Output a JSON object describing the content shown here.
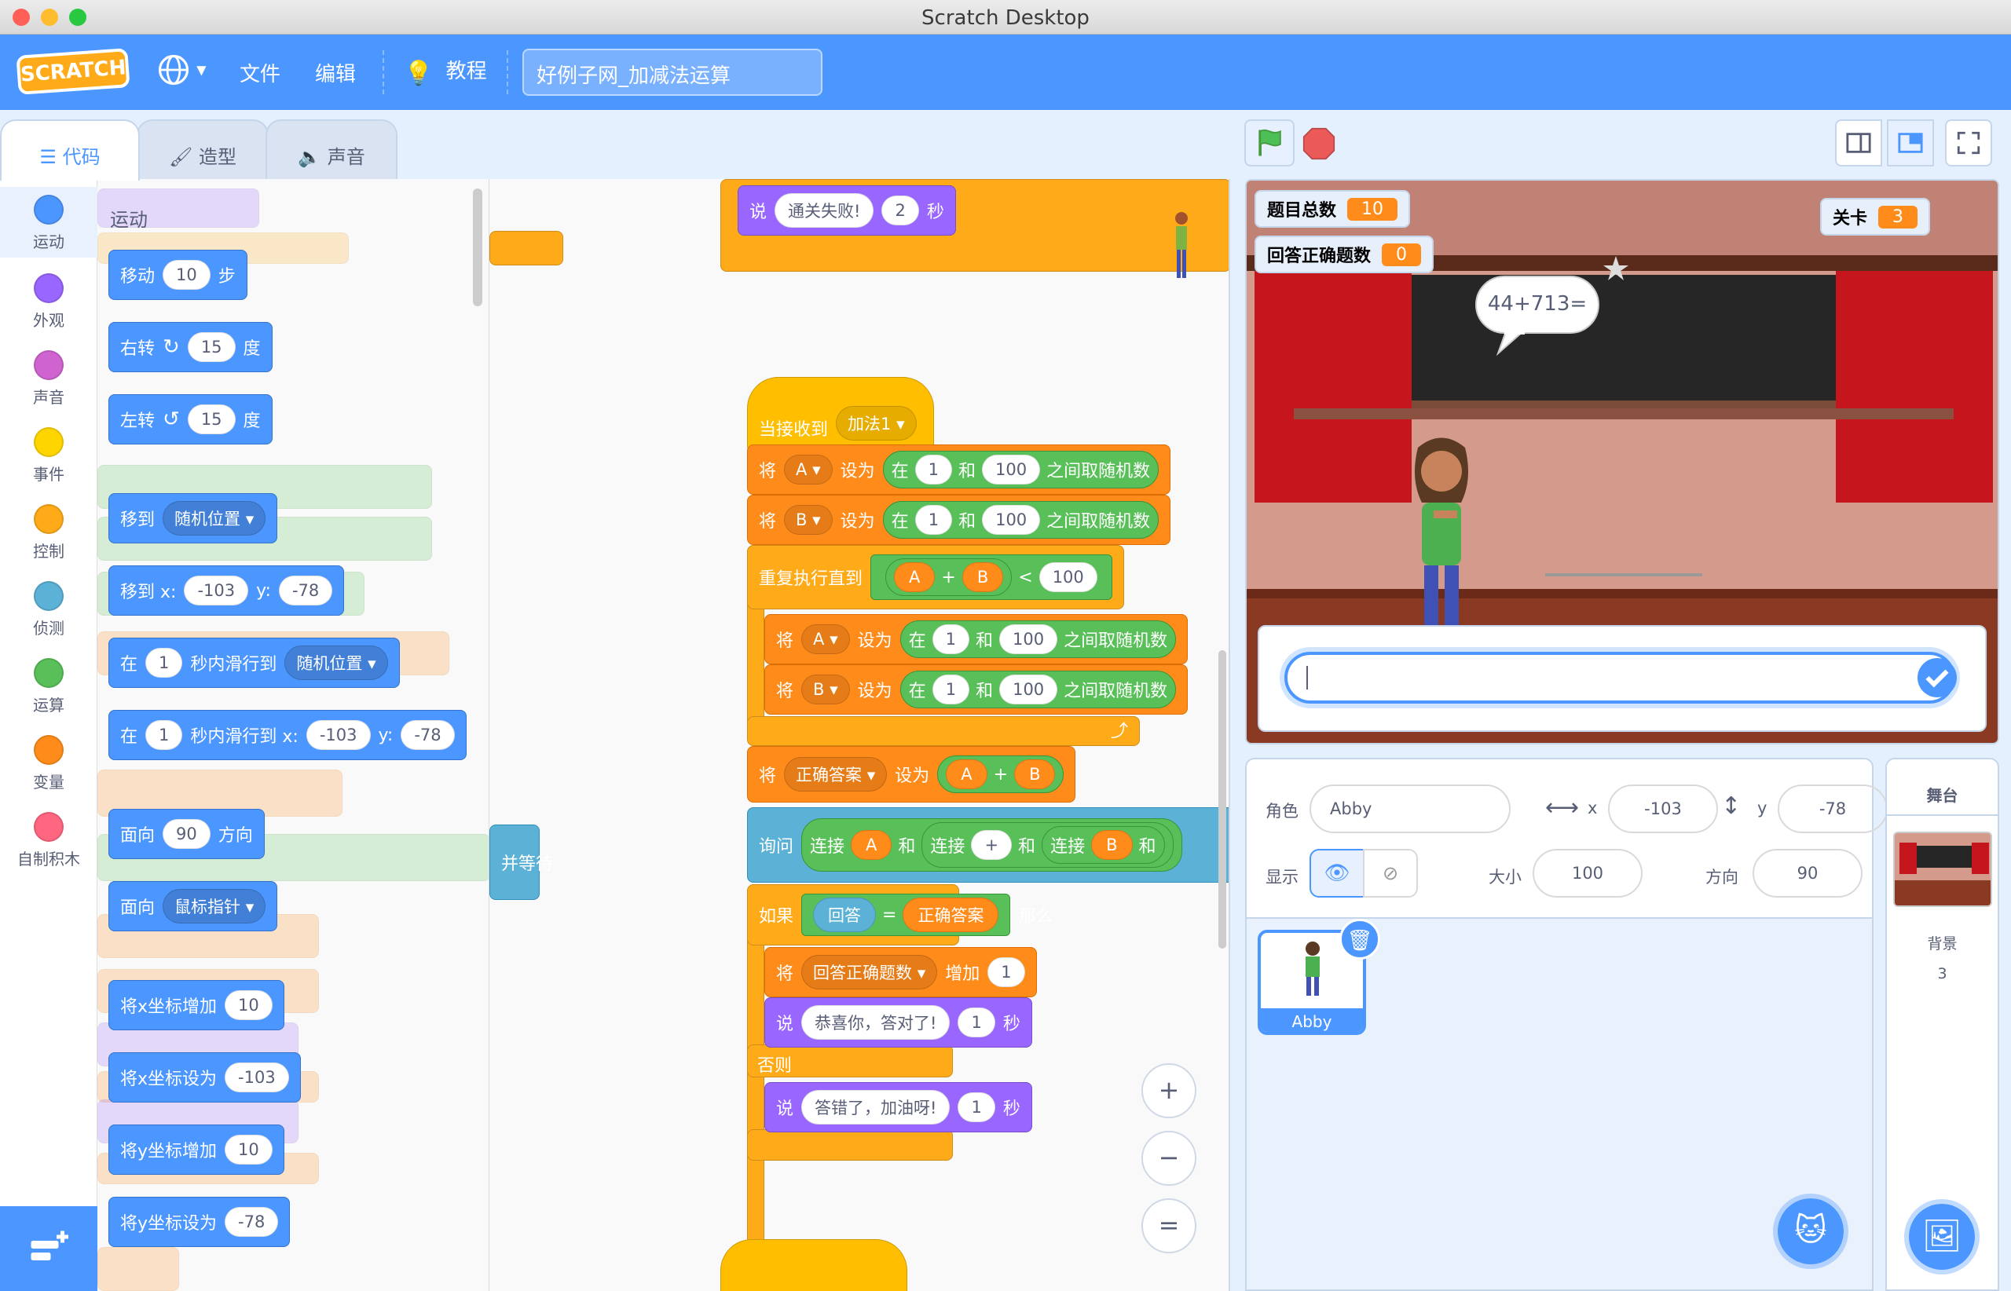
{
  "window": {
    "title": "Scratch Desktop"
  },
  "menubar": {
    "logo": "SCRATCH",
    "file": "文件",
    "edit": "编辑",
    "tutorials": "教程",
    "project_title": "好例子网_加减法运算"
  },
  "tabs": {
    "code": "代码",
    "costumes": "造型",
    "sounds": "声音"
  },
  "categories": [
    {
      "label": "运动",
      "color": "#4c97ff"
    },
    {
      "label": "外观",
      "color": "#9966ff"
    },
    {
      "label": "声音",
      "color": "#cf63cf"
    },
    {
      "label": "事件",
      "color": "#ffd500"
    },
    {
      "label": "控制",
      "color": "#ffab19"
    },
    {
      "label": "侦测",
      "color": "#5cb1d6"
    },
    {
      "label": "运算",
      "color": "#59c059"
    },
    {
      "label": "变量",
      "color": "#ff8c1a"
    },
    {
      "label": "自制积木",
      "color": "#ff6680"
    }
  ],
  "palette": {
    "heading": "运动",
    "move": {
      "label": "移动",
      "value": "10",
      "unit": "步"
    },
    "turn_right": {
      "label": "右转",
      "value": "15",
      "unit": "度"
    },
    "turn_left": {
      "label": "左转",
      "value": "15",
      "unit": "度"
    },
    "goto": {
      "label": "移到",
      "dropdown": "随机位置"
    },
    "goto_xy": {
      "label": "移到 x:",
      "x": "-103",
      "ylabel": "y:",
      "y": "-78"
    },
    "glide": {
      "label": "在",
      "secs": "1",
      "mid": "秒内滑行到",
      "dropdown": "随机位置"
    },
    "glide_xy": {
      "label": "在",
      "secs": "1",
      "mid": "秒内滑行到 x:",
      "x": "-103",
      "ylabel": "y:",
      "y": "-78"
    },
    "point_dir": {
      "label": "面向",
      "value": "90",
      "unit": "方向"
    },
    "point_towards": {
      "label": "面向",
      "dropdown": "鼠标指针"
    },
    "change_x": {
      "label": "将x坐标增加",
      "value": "10"
    },
    "set_x": {
      "label": "将x坐标设为",
      "value": "-103"
    },
    "change_y": {
      "label": "将y坐标增加",
      "value": "10"
    },
    "set_y": {
      "label": "将y坐标设为",
      "value": "-78"
    },
    "behind_wait": "并等待"
  },
  "script": {
    "say_fail": {
      "say": "说",
      "text": "通关失败!",
      "secs": "2",
      "unit": "秒"
    },
    "hat": {
      "label": "当接收到",
      "msg": "加法1"
    },
    "set_a": {
      "set": "将",
      "var": "A",
      "to": "设为",
      "in": "在",
      "from": "1",
      "and": "和",
      "to_val": "100",
      "rand": "之间取随机数"
    },
    "set_b": {
      "set": "将",
      "var": "B",
      "to": "设为",
      "in": "在",
      "from": "1",
      "and": "和",
      "to_val": "100",
      "rand": "之间取随机数"
    },
    "repeat": {
      "label": "重复执行直到",
      "a": "A",
      "plus": "+",
      "b": "B",
      "lt": "<",
      "limit": "100"
    },
    "set_a2": {
      "set": "将",
      "var": "A",
      "to": "设为",
      "in": "在",
      "from": "1",
      "and": "和",
      "to_val": "100",
      "rand": "之间取随机数"
    },
    "set_b2": {
      "set": "将",
      "var": "B",
      "to": "设为",
      "in": "在",
      "from": "1",
      "and": "和",
      "to_val": "100",
      "rand": "之间取随机数"
    },
    "set_answer": {
      "set": "将",
      "var": "正确答案",
      "to": "设为",
      "a": "A",
      "plus": "+",
      "b": "B"
    },
    "ask": {
      "label": "询问",
      "join": "连接",
      "a": "A",
      "and": "和",
      "plus": "+",
      "b": "B"
    },
    "if": {
      "label": "如果",
      "answer": "回答",
      "eq": "=",
      "correct": "正确答案",
      "then": "那么"
    },
    "change_correct": {
      "set": "将",
      "var": "回答正确题数",
      "change": "增加",
      "value": "1"
    },
    "say_ok": {
      "say": "说",
      "text": "恭喜你，答对了!",
      "secs": "1",
      "unit": "秒"
    },
    "else": "否则",
    "say_wrong": {
      "say": "说",
      "text": "答错了，加油呀!",
      "secs": "1",
      "unit": "秒"
    }
  },
  "stage": {
    "monitors": {
      "total": {
        "label": "题目总数",
        "value": "10"
      },
      "level": {
        "label": "关卡",
        "value": "3"
      },
      "correct": {
        "label": "回答正确题数",
        "value": "0"
      }
    },
    "bubble": "44+713="
  },
  "sprite_info": {
    "sprite_label": "角色",
    "sprite_name": "Abby",
    "x_label": "x",
    "x": "-103",
    "y_label": "y",
    "y": "-78",
    "show_label": "显示",
    "size_label": "大小",
    "size": "100",
    "direction_label": "方向",
    "direction": "90"
  },
  "sprites": [
    {
      "name": "Abby"
    }
  ],
  "stage_panel": {
    "title": "舞台",
    "backdrops_label": "背景",
    "backdrops_count": "3"
  },
  "zoom": {
    "in": "+",
    "out": "−",
    "reset": "="
  }
}
